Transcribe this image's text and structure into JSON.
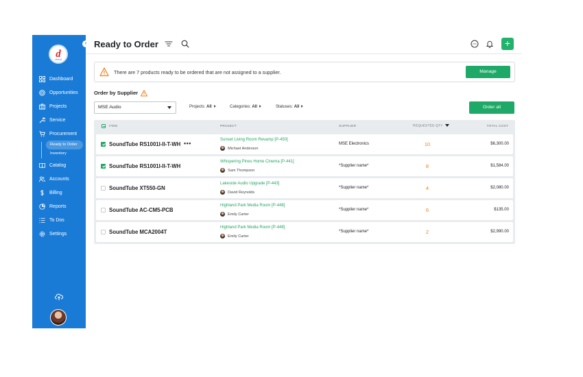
{
  "sidebar": {
    "logo_mark": "d",
    "logo_sub": "cloud",
    "items": [
      {
        "label": "Dashboard",
        "icon": "grid-icon"
      },
      {
        "label": "Opportunities",
        "icon": "target-icon"
      },
      {
        "label": "Projects",
        "icon": "briefcase-icon"
      },
      {
        "label": "Service",
        "icon": "wrench-icon"
      },
      {
        "label": "Procurement",
        "icon": "cart-icon"
      },
      {
        "label": "Catalog",
        "icon": "book-icon"
      },
      {
        "label": "Accounts",
        "icon": "users-icon"
      },
      {
        "label": "Billing",
        "icon": "dollar-icon"
      },
      {
        "label": "Reports",
        "icon": "pie-chart-icon"
      },
      {
        "label": "To Dos",
        "icon": "list-icon"
      },
      {
        "label": "Settings",
        "icon": "gear-icon"
      }
    ],
    "subitems": [
      {
        "label": "Ready to Order"
      },
      {
        "label": "Inventory"
      }
    ]
  },
  "header": {
    "title": "Ready to Order"
  },
  "alert": {
    "text": "There are 7 products ready to be ordered that are not assigned to a supplier.",
    "button": "Manage"
  },
  "order": {
    "title": "Order by Supplier",
    "supplier_selected": "MSE Audio",
    "filters": [
      {
        "label": "Projects:",
        "value": "All"
      },
      {
        "label": "Categories:",
        "value": "All"
      },
      {
        "label": "Statuses:",
        "value": "All"
      }
    ],
    "order_all": "Order all"
  },
  "table": {
    "headers": {
      "item": "ITEM",
      "project": "PROJECT",
      "supplier": "SUPPLIER",
      "qty": "REQUESTED QTY",
      "cost": "TOTAL COST"
    },
    "rows": [
      {
        "checked": true,
        "item": "SoundTube RS1001I-II-T-WH",
        "dots": "•••",
        "project": "Sunset Living Room Revamp [P-450]",
        "person": "Michael Anderson",
        "supplier": "MSE Electronics",
        "qty": "10",
        "cost": "$6,300.00"
      },
      {
        "checked": true,
        "item": "SoundTube RS1001I-II-T-WH",
        "dots": "",
        "project": "Whispering Pines Home Cinema [P-441]",
        "person": "Sam Thompson",
        "supplier": "*Supplier name*",
        "qty": "8",
        "cost": "$1,584.00"
      },
      {
        "checked": false,
        "item": "SoundTube XT550-GN",
        "dots": "",
        "project": "Lakeside Audio Upgrade [P-443]",
        "person": "David Reynolds",
        "supplier": "*Supplier name*",
        "qty": "4",
        "cost": "$2,080.00"
      },
      {
        "checked": false,
        "item": "SoundTube AC-CM5-PCB",
        "dots": "",
        "project": "Highland Park Media Room [P-448]",
        "person": "Emily Carter",
        "supplier": "*Supplier name*",
        "qty": "6",
        "cost": "$135.00"
      },
      {
        "checked": false,
        "item": "SoundTube MCA2004T",
        "dots": "",
        "project": "Highland Park Media Room [P-448]",
        "person": "Emily Carter",
        "supplier": "*Supplier name*",
        "qty": "2",
        "cost": "$2,990.00"
      }
    ]
  },
  "colors": {
    "sidebar": "#1a7bd6",
    "accent_green": "#1fa968",
    "qty_orange": "#f07f1c",
    "warning": "#f07f1c"
  }
}
